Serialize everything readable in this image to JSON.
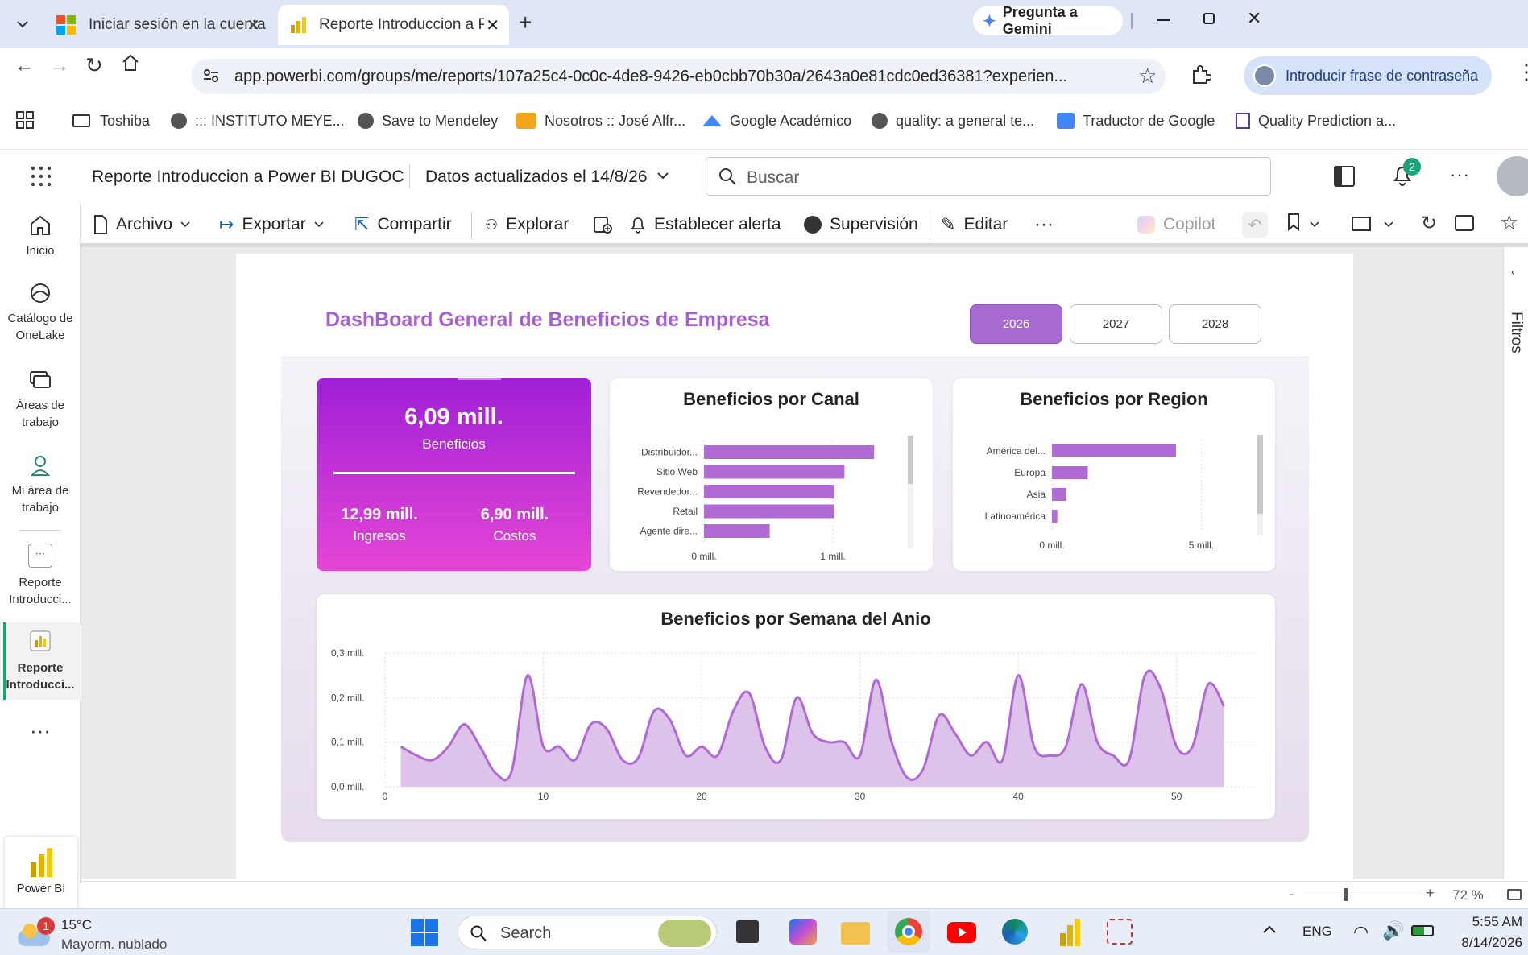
{
  "browser": {
    "tabs": [
      {
        "label": "Iniciar sesión en la cuenta"
      },
      {
        "label": "Reporte Introduccion a Power BI"
      }
    ],
    "gemini_label": "Pregunta a Gemini",
    "url": "app.powerbi.com/groups/me/reports/107a25c4-0c0c-4de8-9426-eb0cbb70b30a/2643a0e81cdc0ed36381?experien...",
    "profile_label": "Introducir frase de contraseña",
    "bookmarks": [
      "Toshiba",
      "::: INSTITUTO MEYE...",
      "Save to Mendeley",
      "Nosotros :: José Alfr...",
      "Google Académico",
      "quality: a general te...",
      "Traductor de Google",
      "Quality Prediction a..."
    ]
  },
  "powerbi": {
    "report_title": "Reporte Introduccion a Power BI DUGOC",
    "updated": "Datos actualizados el 14/8/26",
    "search_placeholder": "Buscar",
    "notif_count": "2",
    "toolbar": {
      "archivo": "Archivo",
      "exportar": "Exportar",
      "compartir": "Compartir",
      "explorar": "Explorar",
      "alerta": "Establecer alerta",
      "supervision": "Supervisión",
      "editar": "Editar",
      "copilot": "Copilot"
    },
    "nav": {
      "inicio": "Inicio",
      "catalogo1": "Catálogo de",
      "catalogo2": "OneLake",
      "areas1": "Áreas de",
      "areas2": "trabajo",
      "mi1": "Mi área de",
      "mi2": "trabajo",
      "rep1a": "Reporte",
      "rep1b": "Introducci...",
      "rep2a": "Reporte",
      "rep2b": "Introducci...",
      "powerbi": "Power BI"
    },
    "filters_label": "Filtros",
    "zoom": "72 %"
  },
  "dashboard": {
    "title": "DashBoard General de Beneficios de Empresa",
    "years": [
      "2026",
      "2027",
      "2028"
    ],
    "selected_year": "2026",
    "kpi": {
      "beneficios_value": "6,09 mill.",
      "beneficios_label": "Beneficios",
      "ingresos_value": "12,99 mill.",
      "ingresos_label": "Ingresos",
      "costos_value": "6,90 mill.",
      "costos_label": "Costos"
    }
  },
  "chart_data": [
    {
      "type": "bar",
      "orientation": "horizontal",
      "title": "Beneficios por Canal",
      "categories": [
        "Distribuidor...",
        "Sitio Web",
        "Revendedor...",
        "Retail",
        "Agente dire..."
      ],
      "values": [
        1.32,
        1.09,
        1.01,
        1.01,
        0.51
      ],
      "xticks": [
        "0 mill.",
        "1 mill."
      ],
      "xlim": [
        0,
        1.5
      ],
      "color": "#b06ad3"
    },
    {
      "type": "bar",
      "orientation": "horizontal",
      "title": "Beneficios por Region",
      "categories": [
        "América del...",
        "Europa",
        "Asia",
        "Latinoamérica"
      ],
      "values": [
        4.15,
        1.2,
        0.48,
        0.18
      ],
      "xticks": [
        "0 mill.",
        "5 mill."
      ],
      "xlim": [
        0,
        6.2
      ],
      "color": "#b06ad3"
    },
    {
      "type": "area",
      "title": "Beneficios por Semana del Anio",
      "x": [
        1,
        2,
        3,
        4,
        5,
        6,
        7,
        8,
        9,
        10,
        11,
        12,
        13,
        14,
        15,
        16,
        17,
        18,
        19,
        20,
        21,
        22,
        23,
        24,
        25,
        26,
        27,
        28,
        29,
        30,
        31,
        32,
        33,
        34,
        35,
        36,
        37,
        38,
        39,
        40,
        41,
        42,
        43,
        44,
        45,
        46,
        47,
        48,
        49,
        50,
        51,
        52,
        53
      ],
      "values": [
        0.09,
        0.07,
        0.06,
        0.09,
        0.14,
        0.09,
        0.03,
        0.035,
        0.25,
        0.09,
        0.09,
        0.06,
        0.14,
        0.13,
        0.06,
        0.065,
        0.17,
        0.15,
        0.07,
        0.09,
        0.07,
        0.17,
        0.21,
        0.09,
        0.06,
        0.2,
        0.12,
        0.1,
        0.1,
        0.07,
        0.24,
        0.1,
        0.02,
        0.04,
        0.16,
        0.12,
        0.07,
        0.1,
        0.06,
        0.25,
        0.09,
        0.07,
        0.09,
        0.23,
        0.1,
        0.07,
        0.06,
        0.25,
        0.22,
        0.09,
        0.09,
        0.23,
        0.18
      ],
      "xticks": [
        0,
        10,
        20,
        30,
        40,
        50
      ],
      "yticks": [
        "0,0 mill.",
        "0,1 mill.",
        "0,2 mill.",
        "0,3 mill."
      ],
      "xlim": [
        0,
        55
      ],
      "ylim": [
        0,
        0.3
      ],
      "color": "#b06ad3"
    }
  ],
  "taskbar": {
    "weather_temp": "15°C",
    "weather_desc": "Mayorm. nublado",
    "weather_badge": "1",
    "search": "Search",
    "lang": "ENG",
    "time": "5:55 AM",
    "date": "8/14/2026"
  }
}
